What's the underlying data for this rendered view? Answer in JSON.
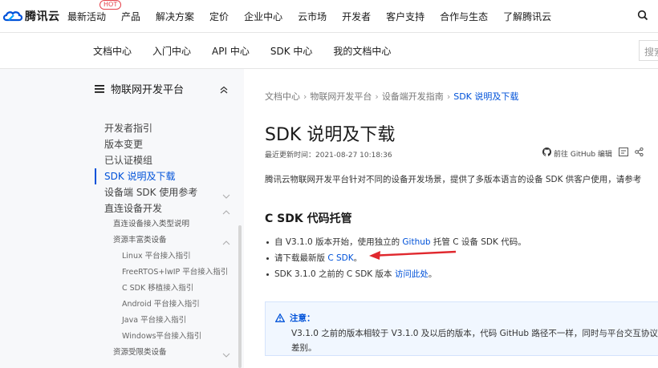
{
  "topnav": {
    "brand": "腾讯云",
    "hot_badge": "HOT",
    "items": [
      {
        "label": "最新活动"
      },
      {
        "label": "产品"
      },
      {
        "label": "解决方案"
      },
      {
        "label": "定价"
      },
      {
        "label": "企业中心"
      },
      {
        "label": "云市场"
      },
      {
        "label": "开发者"
      },
      {
        "label": "客户支持"
      },
      {
        "label": "合作与生态"
      },
      {
        "label": "了解腾讯云"
      }
    ],
    "search_icon": "search-icon"
  },
  "subnav": {
    "items": [
      {
        "label": "文档中心"
      },
      {
        "label": "入门中心"
      },
      {
        "label": "API 中心"
      },
      {
        "label": "SDK 中心"
      },
      {
        "label": "我的文档中心"
      }
    ],
    "search_placeholder": "搜索"
  },
  "sidebar": {
    "title": "物联网开发平台",
    "items": [
      {
        "label": "开发者指引"
      },
      {
        "label": "版本变更"
      },
      {
        "label": "已认证模组"
      },
      {
        "label": "SDK 说明及下载"
      },
      {
        "label": "设备端 SDK 使用参考"
      },
      {
        "label": "直连设备开发"
      },
      {
        "label": "直连设备接入类型说明"
      },
      {
        "label": "资源丰富类设备"
      },
      {
        "label": "Linux 平台接入指引"
      },
      {
        "label": "FreeRTOS+lwIP 平台接入指引"
      },
      {
        "label": "C SDK 移植接入指引"
      },
      {
        "label": "Android 平台接入指引"
      },
      {
        "label": "Java 平台接入指引"
      },
      {
        "label": "Windows平台接入指引"
      },
      {
        "label": "资源受限类设备"
      }
    ]
  },
  "main": {
    "breadcrumb": [
      "文档中心",
      "物联网开发平台",
      "设备端开发指南",
      "SDK 说明及下载"
    ],
    "title": "SDK 说明及下载",
    "updated": "最近更新时间：2021-08-27 10:18:36",
    "tools": {
      "github_edit": "前往 GitHub 编辑"
    },
    "intro": "腾讯云物联网开发平台针对不同的设备开发场景，提供了多版本语言的设备 SDK 供客户使用，请参考",
    "section_title": "C SDK 代码托管",
    "bullets": {
      "b1_pre": "自 V3.1.0 版本开始，使用独立的 ",
      "b1_link": "Github",
      "b1_post": " 托管 C 设备 SDK 代码。",
      "b2_pre": "请下载最新版 ",
      "b2_link": "C SDK",
      "b2_post": "。",
      "b3_pre": "SDK 3.1.0 之前的 C SDK 版本 ",
      "b3_link": "访问此处",
      "b3_post": "。"
    },
    "note": {
      "label": "注意：",
      "text": "V3.1.0 之前的版本相较于 V3.1.0 及以后的版本，代码 GitHub 路径不一样，同时与平台交互协议的差别。"
    }
  },
  "colors": {
    "brand_blue": "#0052d9",
    "hot_red": "#e5414a",
    "arrow_red": "#e0282e"
  }
}
